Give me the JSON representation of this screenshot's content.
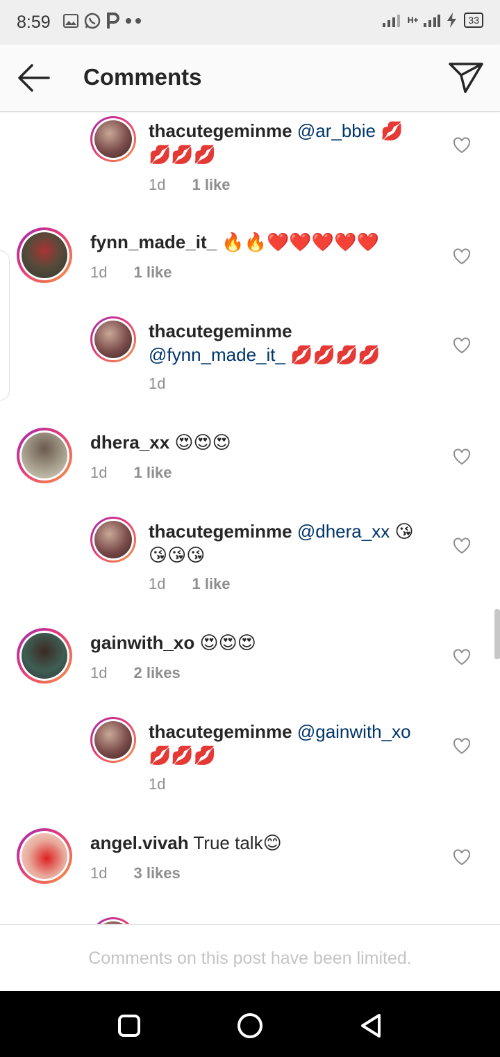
{
  "status_bar": {
    "time": "8:59",
    "network": "H+",
    "battery": "33",
    "icons": [
      "gallery-icon",
      "whatsapp-icon",
      "p-icon",
      "more-dots-icon",
      "signal-icon",
      "charging-icon"
    ]
  },
  "header": {
    "title": "Comments",
    "back_icon": "back-arrow-icon",
    "send_icon": "direct-send-icon"
  },
  "comments": [
    {
      "username": "thacutegeminme",
      "mention": "@ar_bbie",
      "emoji": "💋💋💋💋",
      "time": "1d",
      "likes": "1 like",
      "reply": true
    },
    {
      "username": "fynn_made_it_",
      "mention": "",
      "emoji": "🔥🔥❤️❤️❤️❤️❤️",
      "time": "1d",
      "likes": "1 like",
      "reply": false
    },
    {
      "username": "thacutegeminme",
      "mention": "@fynn_made_it_",
      "emoji": "💋💋💋💋",
      "time": "1d",
      "likes": "",
      "reply": true
    },
    {
      "username": "dhera_xx",
      "mention": "",
      "emoji": "😍😍😍",
      "time": "1d",
      "likes": "1 like",
      "reply": false
    },
    {
      "username": "thacutegeminme",
      "mention": "@dhera_xx",
      "emoji": "😘😘😘😘",
      "time": "1d",
      "likes": "1 like",
      "reply": true
    },
    {
      "username": "gainwith_xo",
      "mention": "",
      "emoji": "😍😍😍",
      "time": "1d",
      "likes": "2 likes",
      "reply": false
    },
    {
      "username": "thacutegeminme",
      "mention": "@gainwith_xo",
      "emoji": "💋💋💋",
      "time": "1d",
      "likes": "",
      "reply": true
    },
    {
      "username": "angel.vivah",
      "mention": "",
      "body": "True talk",
      "emoji": "😊",
      "time": "1d",
      "likes": "3 likes",
      "reply": false
    }
  ],
  "footer": {
    "text": "Comments on this post have been limited."
  },
  "nav_bar": {
    "icons": [
      "recents-square-icon",
      "home-circle-icon",
      "back-triangle-icon"
    ]
  }
}
